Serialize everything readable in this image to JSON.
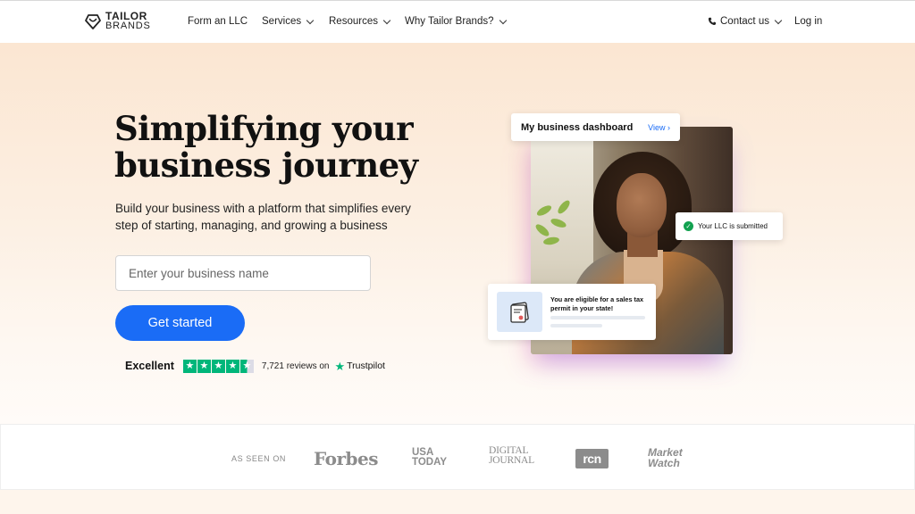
{
  "header": {
    "logo": {
      "line1": "TAILOR",
      "line2": "BRANDS"
    },
    "nav": [
      {
        "label": "Form an LLC",
        "has_dropdown": false
      },
      {
        "label": "Services",
        "has_dropdown": true
      },
      {
        "label": "Resources",
        "has_dropdown": true
      },
      {
        "label": "Why Tailor Brands?",
        "has_dropdown": true
      }
    ],
    "contact": {
      "label": "Contact us",
      "icon": "phone-icon",
      "has_dropdown": true
    },
    "login": {
      "label": "Log in"
    }
  },
  "hero": {
    "headline": "Simplifying your business journey",
    "subcopy": "Build your business with a platform that simplifies every step of starting, managing, and growing a business",
    "input_placeholder": "Enter your business name",
    "input_value": "",
    "cta_label": "Get started",
    "trustpilot": {
      "rating_label": "Excellent",
      "stars": 4.5,
      "reviews_text": "7,721 reviews on",
      "brand": "Trustpilot"
    }
  },
  "illustration": {
    "dashboard_card": {
      "title": "My business dashboard",
      "link": "View"
    },
    "llc_card": {
      "text": "Your LLC is submitted"
    },
    "tax_card": {
      "text": "You are eligible for a sales tax permit in your state!"
    }
  },
  "press": {
    "label": "AS SEEN ON",
    "logos": [
      "Forbes",
      "USA TODAY",
      "DIGITAL JOURNAL",
      "rcn",
      "Market Watch"
    ]
  },
  "colors": {
    "accent": "#1a6cf6",
    "trustpilot_green": "#00b67a",
    "success_green": "#12a150",
    "hero_bg": "#fbe6d2"
  }
}
